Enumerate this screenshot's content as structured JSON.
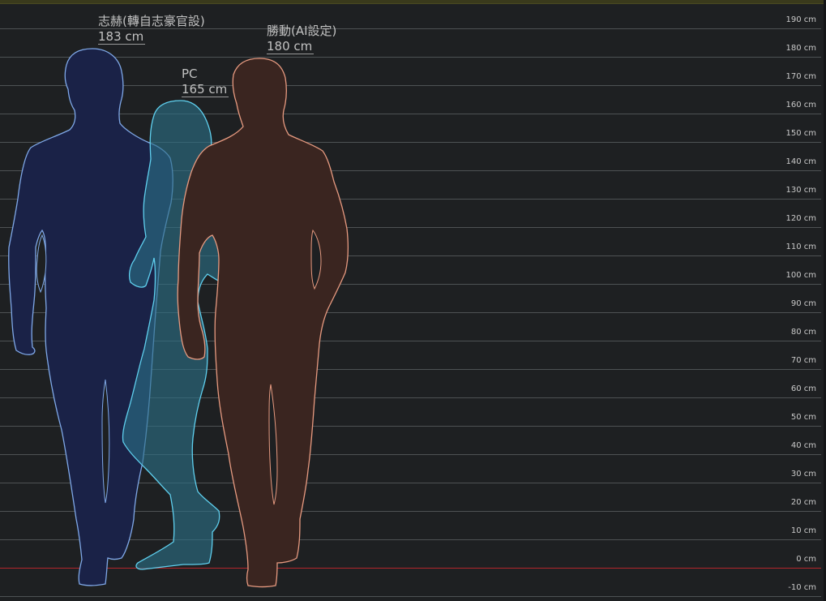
{
  "scale": {
    "unit": "cm",
    "ticks": [
      {
        "value": 190,
        "label": "190 cm"
      },
      {
        "value": 180,
        "label": "180 cm"
      },
      {
        "value": 170,
        "label": "170 cm"
      },
      {
        "value": 160,
        "label": "160 cm"
      },
      {
        "value": 150,
        "label": "150 cm"
      },
      {
        "value": 140,
        "label": "140 cm"
      },
      {
        "value": 130,
        "label": "130 cm"
      },
      {
        "value": 120,
        "label": "120 cm"
      },
      {
        "value": 110,
        "label": "110 cm"
      },
      {
        "value": 100,
        "label": "100 cm"
      },
      {
        "value": 90,
        "label": "90 cm"
      },
      {
        "value": 80,
        "label": "80 cm"
      },
      {
        "value": 70,
        "label": "70 cm"
      },
      {
        "value": 60,
        "label": "60 cm"
      },
      {
        "value": 50,
        "label": "50 cm"
      },
      {
        "value": 40,
        "label": "40 cm"
      },
      {
        "value": 30,
        "label": "30 cm"
      },
      {
        "value": 20,
        "label": "20 cm"
      },
      {
        "value": 10,
        "label": "10 cm"
      },
      {
        "value": 0,
        "label": "0 cm"
      },
      {
        "value": -10,
        "label": "-10 cm"
      }
    ],
    "zero_line_color": "#b3262b",
    "grid_color": "#4e5254"
  },
  "characters": [
    {
      "name": "志赫(轉自志豪官設)",
      "height_label": "183 cm",
      "height_cm": 183,
      "fill": "#1a2247",
      "stroke": "#7fa8e8",
      "icon": "male-silhouette-icon"
    },
    {
      "name": "PC",
      "height_label": "165 cm",
      "height_cm": 165,
      "fill": "#2b6f86",
      "stroke": "#5fd0ef",
      "icon": "female-silhouette-icon"
    },
    {
      "name": "勝動(AI設定)",
      "height_label": "180 cm",
      "height_cm": 180,
      "fill": "#3a2520",
      "stroke": "#e79a80",
      "icon": "male-silhouette-icon"
    }
  ]
}
